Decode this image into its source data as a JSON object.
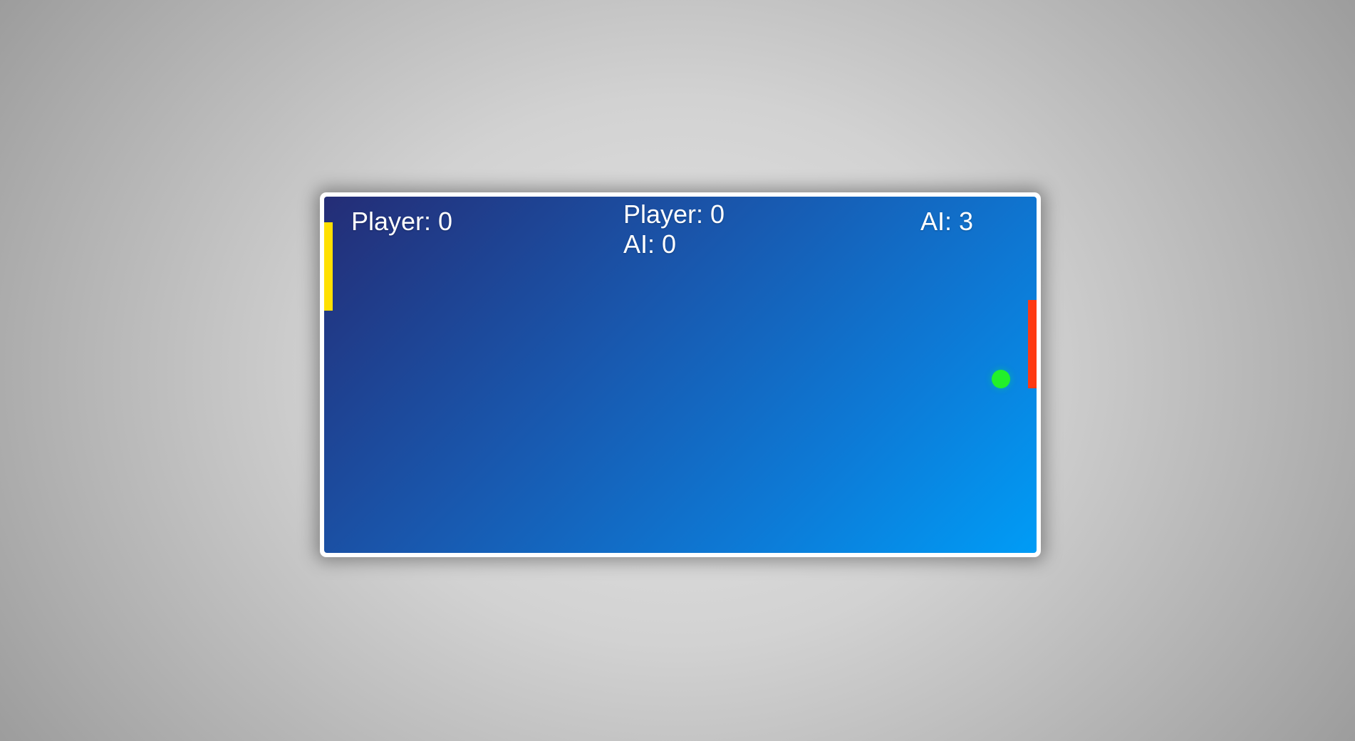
{
  "scoreboard": {
    "left_label": "Player: 0",
    "right_label": "AI: 3",
    "center_player": "Player: 0",
    "center_ai": "AI: 0"
  },
  "colors": {
    "frame_border": "#ffffff",
    "field_gradient_start": "#242d76",
    "field_gradient_end": "#009cf6",
    "player_paddle": "#ffe000",
    "ai_paddle": "#ff3a12",
    "ball": "#22f02a",
    "score_text": "#ffffff"
  }
}
